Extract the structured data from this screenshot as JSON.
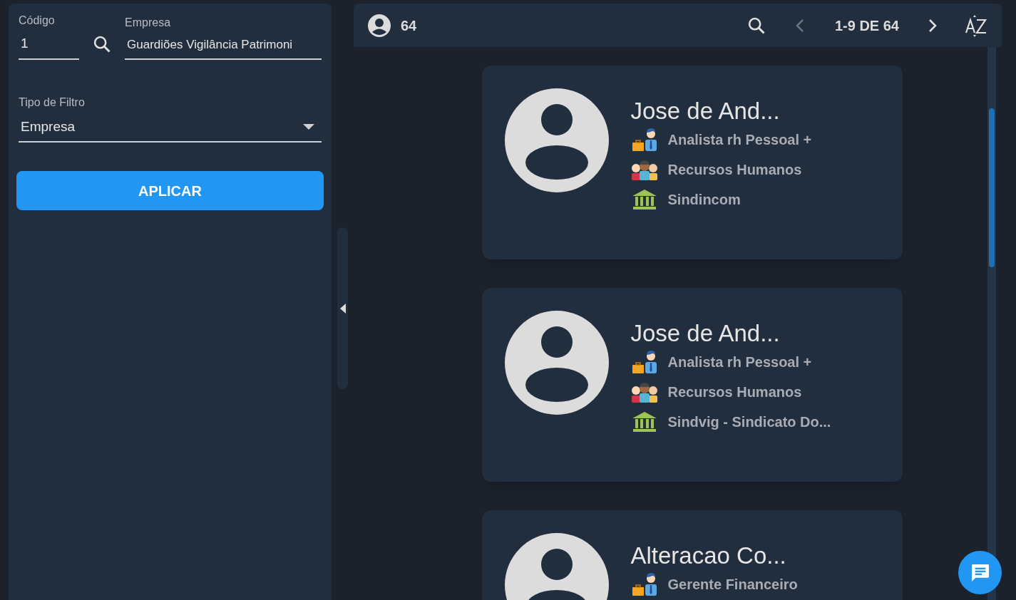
{
  "filter_panel": {
    "code_field": {
      "label": "Código",
      "value": "1"
    },
    "company_field": {
      "label": "Empresa",
      "value": "Guardiões Vigilância Patrimoni"
    },
    "filter_type": {
      "label": "Tipo de Filtro",
      "value": "Empresa"
    },
    "apply_button": "APLICAR"
  },
  "toolbar": {
    "count": "64",
    "range": "1-9 DE 64",
    "prev_disabled": true,
    "next_disabled": false
  },
  "cards": [
    {
      "name": "Jose de And...",
      "details": [
        {
          "kind": "job",
          "text": "Analista rh Pessoal +"
        },
        {
          "kind": "department",
          "text": "Recursos Humanos"
        },
        {
          "kind": "union",
          "text": "Sindincom"
        }
      ]
    },
    {
      "name": "Jose de And...",
      "details": [
        {
          "kind": "job",
          "text": "Analista rh Pessoal +"
        },
        {
          "kind": "department",
          "text": "Recursos Humanos"
        },
        {
          "kind": "union",
          "text": "Sindvig - Sindicato Do..."
        }
      ]
    },
    {
      "name": "Alteracao Co...",
      "details": [
        {
          "kind": "job",
          "text": "Gerente Financeiro"
        }
      ]
    }
  ]
}
